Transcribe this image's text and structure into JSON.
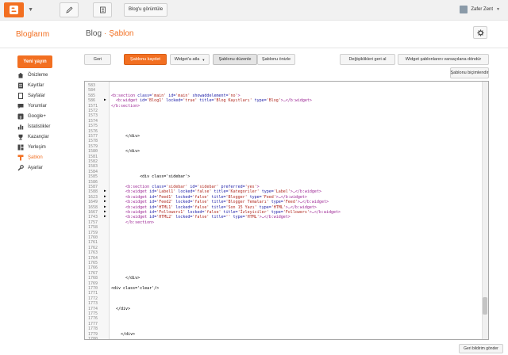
{
  "topbar": {
    "view_blog": "Blog'u görüntüle",
    "user_name": "Zafer Zent"
  },
  "header": {
    "brand": "Bloglarım",
    "crumb_blog": "Blog",
    "crumb_sep": "·",
    "crumb_current": "Şablon"
  },
  "sidebar": {
    "new_post": "Yeni yayın",
    "items": [
      {
        "label": "Önizleme",
        "icon": "home-icon"
      },
      {
        "label": "Kayıtlar",
        "icon": "posts-icon"
      },
      {
        "label": "Sayfalar",
        "icon": "pages-icon"
      },
      {
        "label": "Yorumlar",
        "icon": "comments-icon"
      },
      {
        "label": "Google+",
        "icon": "google-plus-icon"
      },
      {
        "label": "İstatistikler",
        "icon": "stats-icon"
      },
      {
        "label": "Kazançlar",
        "icon": "earnings-icon"
      },
      {
        "label": "Yerleşim",
        "icon": "layout-icon"
      },
      {
        "label": "Şablon",
        "icon": "template-icon"
      },
      {
        "label": "Ayarlar",
        "icon": "settings-icon"
      }
    ]
  },
  "toolbar": {
    "back": "Geri",
    "save_template": "Şablonu kaydet",
    "jump_widget": "Widget'a atla",
    "edit_template": "Şablonu düzenle",
    "preview_template": "Şablonu önizle",
    "revert": "Değişiklikleri geri al",
    "revert_widgets": "Widget şablonlarını varsayılana döndür",
    "format_template": "Şablonu biçimlendir"
  },
  "editor": {
    "lines": [
      {
        "n": "583",
        "fold": "",
        "segs": []
      },
      {
        "n": "584",
        "fold": "",
        "segs": []
      },
      {
        "n": "585",
        "fold": "",
        "segs": [
          {
            "c": "tg",
            "t": "<b:section "
          },
          {
            "c": "at",
            "t": "class="
          },
          {
            "c": "vl",
            "t": "'main'"
          },
          {
            "c": "at",
            "t": " id="
          },
          {
            "c": "vl",
            "t": "'main'"
          },
          {
            "c": "at",
            "t": " showaddelement="
          },
          {
            "c": "vl",
            "t": "'no'"
          },
          {
            "c": "tg",
            "t": ">"
          }
        ]
      },
      {
        "n": "586",
        "fold": "▶",
        "segs": [
          {
            "c": "tg",
            "t": "  <b:widget "
          },
          {
            "c": "at",
            "t": "id="
          },
          {
            "c": "vl",
            "t": "'Blog1'"
          },
          {
            "c": "at",
            "t": " locked="
          },
          {
            "c": "vl",
            "t": "'true'"
          },
          {
            "c": "at",
            "t": " title="
          },
          {
            "c": "vl",
            "t": "'Blog Kayıtları'"
          },
          {
            "c": "at",
            "t": " type="
          },
          {
            "c": "vl",
            "t": "'Blog'"
          },
          {
            "c": "tg",
            "t": ">…</b:widget>"
          }
        ]
      },
      {
        "n": "1571",
        "fold": "",
        "segs": [
          {
            "c": "tg",
            "t": "</b:section>"
          }
        ]
      },
      {
        "n": "1572",
        "fold": "",
        "segs": []
      },
      {
        "n": "1573",
        "fold": "",
        "segs": []
      },
      {
        "n": "1574",
        "fold": "",
        "segs": []
      },
      {
        "n": "1575",
        "fold": "",
        "segs": []
      },
      {
        "n": "1576",
        "fold": "",
        "segs": []
      },
      {
        "n": "1577",
        "fold": "",
        "segs": [
          {
            "c": "pl",
            "t": "      </div>"
          }
        ]
      },
      {
        "n": "1578",
        "fold": "",
        "segs": []
      },
      {
        "n": "1579",
        "fold": "",
        "segs": []
      },
      {
        "n": "1580",
        "fold": "",
        "segs": [
          {
            "c": "pl",
            "t": "      </div>"
          }
        ]
      },
      {
        "n": "1581",
        "fold": "",
        "segs": []
      },
      {
        "n": "1582",
        "fold": "",
        "segs": []
      },
      {
        "n": "1583",
        "fold": "",
        "segs": []
      },
      {
        "n": "1584",
        "fold": "",
        "segs": []
      },
      {
        "n": "1585",
        "fold": "",
        "segs": [
          {
            "c": "pl",
            "t": "            <div class='sidebar'>"
          }
        ]
      },
      {
        "n": "1586",
        "fold": "",
        "segs": []
      },
      {
        "n": "1587",
        "fold": "",
        "segs": [
          {
            "c": "tg",
            "t": "      <b:section "
          },
          {
            "c": "at",
            "t": "class="
          },
          {
            "c": "vl",
            "t": "'sidebar'"
          },
          {
            "c": "at",
            "t": " id="
          },
          {
            "c": "vl",
            "t": "'sidebar'"
          },
          {
            "c": "at",
            "t": " preferred="
          },
          {
            "c": "vl",
            "t": "'yes'"
          },
          {
            "c": "tg",
            "t": ">"
          }
        ]
      },
      {
        "n": "1588",
        "fold": "▶",
        "segs": [
          {
            "c": "tg",
            "t": "      <b:widget "
          },
          {
            "c": "at",
            "t": "id="
          },
          {
            "c": "vl",
            "t": "'Label1'"
          },
          {
            "c": "at",
            "t": " locked="
          },
          {
            "c": "vl",
            "t": "'false'"
          },
          {
            "c": "at",
            "t": " title="
          },
          {
            "c": "vl",
            "t": "'Kategoriler'"
          },
          {
            "c": "at",
            "t": " type="
          },
          {
            "c": "vl",
            "t": "'Label'"
          },
          {
            "c": "tg",
            "t": ">…</b:widget>"
          }
        ]
      },
      {
        "n": "1623",
        "fold": "▶",
        "segs": [
          {
            "c": "tg",
            "t": "      <b:widget "
          },
          {
            "c": "at",
            "t": "id="
          },
          {
            "c": "vl",
            "t": "'Feed1'"
          },
          {
            "c": "at",
            "t": " locked="
          },
          {
            "c": "vl",
            "t": "'false'"
          },
          {
            "c": "at",
            "t": " title="
          },
          {
            "c": "vl",
            "t": "'Blogger'"
          },
          {
            "c": "at",
            "t": " type="
          },
          {
            "c": "vl",
            "t": "'Feed'"
          },
          {
            "c": "tg",
            "t": ">…</b:widget>"
          }
        ]
      },
      {
        "n": "1649",
        "fold": "▶",
        "segs": [
          {
            "c": "tg",
            "t": "      <b:widget "
          },
          {
            "c": "at",
            "t": "id="
          },
          {
            "c": "vl",
            "t": "'Feed2'"
          },
          {
            "c": "at",
            "t": " locked="
          },
          {
            "c": "vl",
            "t": "'false'"
          },
          {
            "c": "at",
            "t": " title="
          },
          {
            "c": "vl",
            "t": "'Blogger Temaları'"
          },
          {
            "c": "at",
            "t": " type="
          },
          {
            "c": "vl",
            "t": "'Feed'"
          },
          {
            "c": "tg",
            "t": ">…</b:widget>"
          }
        ]
      },
      {
        "n": "1658",
        "fold": "▶",
        "segs": [
          {
            "c": "tg",
            "t": "      <b:widget "
          },
          {
            "c": "at",
            "t": "id="
          },
          {
            "c": "vl",
            "t": "'HTML1'"
          },
          {
            "c": "at",
            "t": " locked="
          },
          {
            "c": "vl",
            "t": "'false'"
          },
          {
            "c": "at",
            "t": " title="
          },
          {
            "c": "vl",
            "t": "'Son 15 Yazı'"
          },
          {
            "c": "at",
            "t": " type="
          },
          {
            "c": "vl",
            "t": "'HTML'"
          },
          {
            "c": "tg",
            "t": ">…</b:widget>"
          }
        ]
      },
      {
        "n": "1667",
        "fold": "▶",
        "segs": [
          {
            "c": "tg",
            "t": "      <b:widget "
          },
          {
            "c": "at",
            "t": "id="
          },
          {
            "c": "vl",
            "t": "'Followers1'"
          },
          {
            "c": "at",
            "t": " locked="
          },
          {
            "c": "vl",
            "t": "'false'"
          },
          {
            "c": "at",
            "t": " title="
          },
          {
            "c": "vl",
            "t": "'İzleyiciler'"
          },
          {
            "c": "at",
            "t": " type="
          },
          {
            "c": "vl",
            "t": "'Followers'"
          },
          {
            "c": "tg",
            "t": ">…</b:widget>"
          }
        ]
      },
      {
        "n": "1743",
        "fold": "▶",
        "segs": [
          {
            "c": "tg",
            "t": "      <b:widget "
          },
          {
            "c": "at",
            "t": "id="
          },
          {
            "c": "vl",
            "t": "'HTML2'"
          },
          {
            "c": "at",
            "t": " locked="
          },
          {
            "c": "vl",
            "t": "'false'"
          },
          {
            "c": "at",
            "t": " title="
          },
          {
            "c": "vl",
            "t": "''"
          },
          {
            "c": "at",
            "t": " type="
          },
          {
            "c": "vl",
            "t": "'HTML'"
          },
          {
            "c": "tg",
            "t": ">…</b:widget>"
          }
        ]
      },
      {
        "n": "1757",
        "fold": "",
        "segs": [
          {
            "c": "tg",
            "t": "      </b:section>"
          }
        ]
      },
      {
        "n": "1758",
        "fold": "",
        "segs": []
      },
      {
        "n": "1759",
        "fold": "",
        "segs": []
      },
      {
        "n": "1760",
        "fold": "",
        "segs": []
      },
      {
        "n": "1761",
        "fold": "",
        "segs": []
      },
      {
        "n": "1762",
        "fold": "",
        "segs": []
      },
      {
        "n": "1763",
        "fold": "",
        "segs": []
      },
      {
        "n": "1764",
        "fold": "",
        "segs": []
      },
      {
        "n": "1765",
        "fold": "",
        "segs": []
      },
      {
        "n": "1766",
        "fold": "",
        "segs": []
      },
      {
        "n": "1767",
        "fold": "",
        "segs": []
      },
      {
        "n": "1768",
        "fold": "",
        "segs": [
          {
            "c": "pl",
            "t": "      </div>"
          }
        ]
      },
      {
        "n": "1769",
        "fold": "",
        "segs": []
      },
      {
        "n": "1770",
        "fold": "",
        "segs": [
          {
            "c": "pl",
            "t": "<div class='clear'/>"
          }
        ]
      },
      {
        "n": "1771",
        "fold": "",
        "segs": []
      },
      {
        "n": "1772",
        "fold": "",
        "segs": []
      },
      {
        "n": "1773",
        "fold": "",
        "segs": []
      },
      {
        "n": "1774",
        "fold": "",
        "segs": [
          {
            "c": "pl",
            "t": "  </div>"
          }
        ]
      },
      {
        "n": "1775",
        "fold": "",
        "segs": []
      },
      {
        "n": "1776",
        "fold": "",
        "segs": []
      },
      {
        "n": "1777",
        "fold": "",
        "segs": []
      },
      {
        "n": "1778",
        "fold": "",
        "segs": []
      },
      {
        "n": "1779",
        "fold": "",
        "segs": [
          {
            "c": "pl",
            "t": "    </div>"
          }
        ]
      },
      {
        "n": "1780",
        "fold": "",
        "segs": []
      },
      {
        "n": "1781",
        "fold": "",
        "segs": []
      }
    ]
  },
  "footer": {
    "feedback": "Geri bildirim gönder"
  },
  "colors": {
    "accent": "#f26f21",
    "tag": "#9b2393",
    "attr": "#1a1aa6",
    "value": "#b0281e"
  }
}
